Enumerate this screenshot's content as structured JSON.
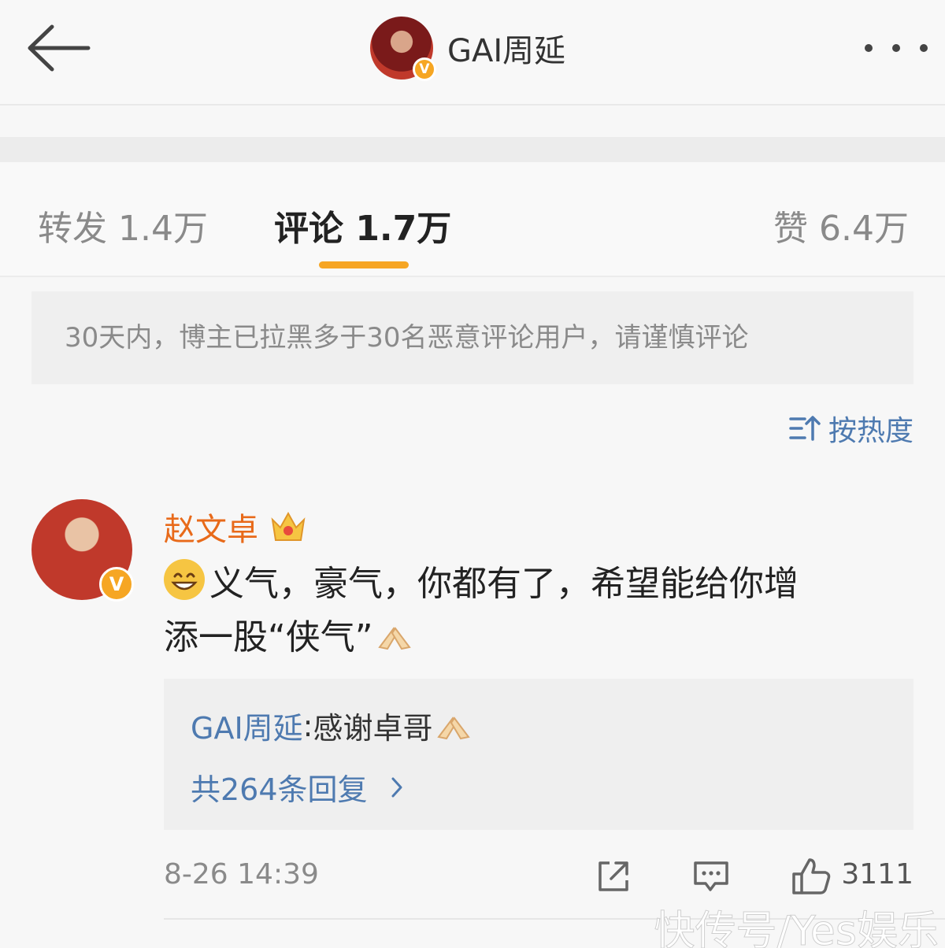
{
  "header": {
    "title": "GAI周延",
    "back_icon": "arrow-left-icon",
    "more_icon": "more-dots-icon",
    "verified_badge": "V"
  },
  "tabs": [
    {
      "label": "转发 1.4万",
      "active": false
    },
    {
      "label": "评论 1.7万",
      "active": true
    },
    {
      "label": "赞 6.4万",
      "active": false
    }
  ],
  "notice": "30天内，博主已拉黑多于30名恶意评论用户，请谨慎评论",
  "sort": {
    "label": "按热度",
    "icon": "sort-icon"
  },
  "comment": {
    "author": "赵文卓",
    "verified_badge": "V",
    "text_line1": "义气，豪气，你都有了，希望能给你增",
    "text_line2": "添一股“侠气”",
    "reply": {
      "name": "GAI周延",
      "separator": ": ",
      "text": "感谢卓哥",
      "count_label": "共264条回复"
    },
    "timestamp": "8-26 14:39",
    "like_count": "3111"
  },
  "colors": {
    "accent": "#f6a623",
    "link": "#4e7ab0",
    "author": "#e86a1a"
  },
  "watermark": "快传号/Yes娱乐"
}
